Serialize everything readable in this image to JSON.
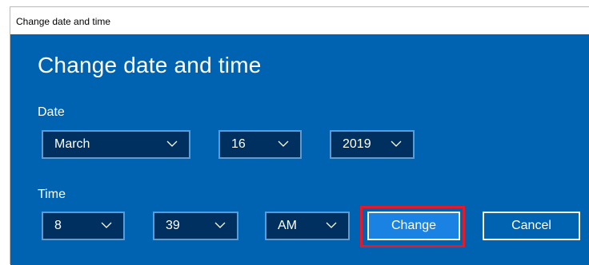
{
  "window": {
    "title": "Change date and time"
  },
  "panel": {
    "heading": "Change date and time",
    "date_label": "Date",
    "time_label": "Time"
  },
  "date": {
    "month": "March",
    "day": "16",
    "year": "2019"
  },
  "time": {
    "hour": "8",
    "minute": "39",
    "period": "AM"
  },
  "buttons": {
    "change": "Change",
    "cancel": "Cancel"
  },
  "colors": {
    "panel_bg": "#0063b1",
    "select_bg": "#00305f",
    "primary_button": "#1a82e2",
    "highlight": "#e21a2a"
  },
  "icons": {
    "dropdown": "chevron-down-icon"
  }
}
